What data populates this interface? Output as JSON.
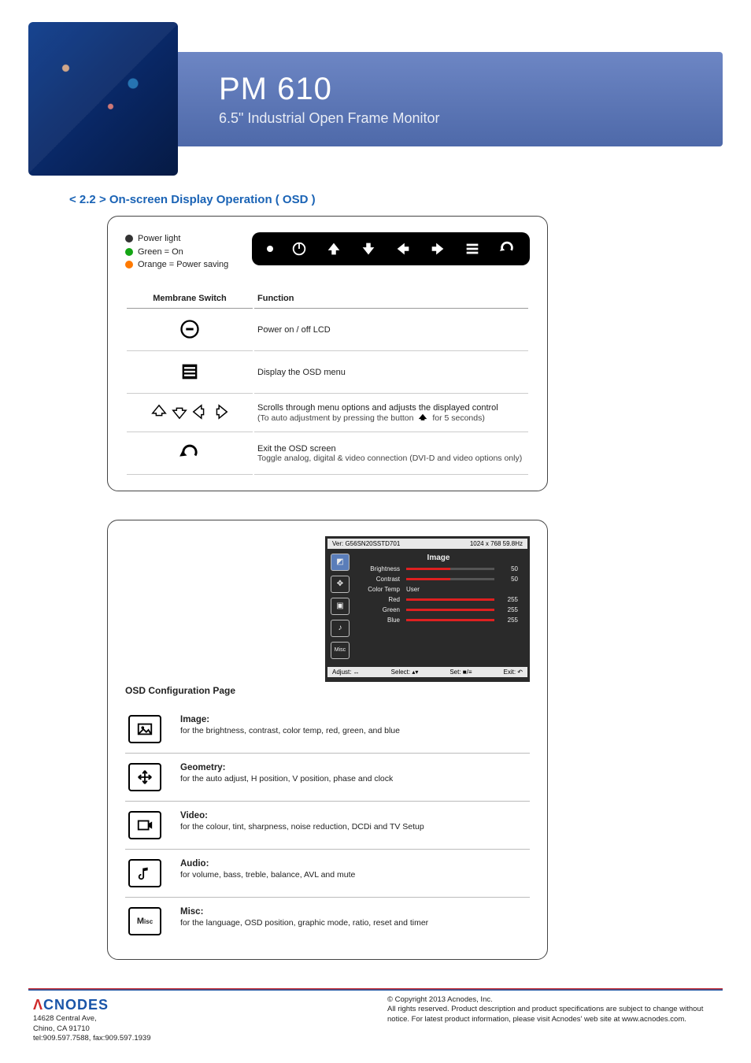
{
  "header": {
    "title": "PM 610",
    "subtitle": "6.5\" Industrial Open Frame Monitor"
  },
  "section_title": "< 2.2 > On-screen Display Operation ( OSD )",
  "legend": {
    "power_light": "Power light",
    "green_on": "Green = On",
    "orange_ps": "Orange = Power saving"
  },
  "switch_table": {
    "col1": "Membrane Switch",
    "col2": "Function",
    "rows": [
      {
        "icon": "power-icon",
        "fn": "Power on / off LCD"
      },
      {
        "icon": "menu-icon",
        "fn": "Display the OSD menu"
      },
      {
        "icon": "arrows-icon",
        "fn": "Scrolls through menu options and adjusts the displayed control",
        "fn2a": "(To auto adjustment by pressing the button",
        "fn2b": "for 5 seconds)"
      },
      {
        "icon": "exit-icon",
        "fn": "Exit the OSD screen",
        "fn2": "Toggle analog, digital & video connection (DVI-D and video options only)"
      }
    ]
  },
  "osd_screen": {
    "ver": "Ver: G56SN20SSTD701",
    "res": "1024 x 768  59.8Hz",
    "menu_title": "Image",
    "rows": [
      {
        "label": "Brightness",
        "value": 50,
        "max": 100
      },
      {
        "label": "Contrast",
        "value": 50,
        "max": 100
      },
      {
        "label": "Color Temp",
        "text": "User"
      },
      {
        "label": "Red",
        "value": 255,
        "max": 255
      },
      {
        "label": "Green",
        "value": 255,
        "max": 255
      },
      {
        "label": "Blue",
        "value": 255,
        "max": 255
      }
    ],
    "footer": {
      "adjust": "Adjust: ↔",
      "select": "Select: ▴▾",
      "set": "Set: ■/≡",
      "exit": "Exit: ↶"
    }
  },
  "config_title": "OSD Configuration Page",
  "config_items": [
    {
      "name": "image-icon",
      "label": "Image:",
      "desc": "for the brightness, contrast, color temp, red, green, and blue"
    },
    {
      "name": "geometry-icon",
      "label": "Geometry:",
      "desc": "for the auto adjust, H position, V position, phase and clock"
    },
    {
      "name": "video-icon",
      "label": "Video:",
      "desc": "for the colour, tint, sharpness, noise reduction, DCDi and TV Setup"
    },
    {
      "name": "audio-icon",
      "label": "Audio:",
      "desc": "for volume, bass, treble, balance, AVL and mute"
    },
    {
      "name": "misc-icon",
      "label": "Misc:",
      "desc": "for the language, OSD position, graphic mode, ratio, reset and timer"
    }
  ],
  "footer": {
    "brand": "ACNODES",
    "addr1": "14628 Central Ave,",
    "addr2": "Chino, CA 91710",
    "tel": "tel:909.597.7588, fax:909.597.1939",
    "copy": "© Copyright 2013 Acnodes, Inc.",
    "legal": "All rights reserved. Product description and product specifications are subject to change without notice. For latest product information, please visit Acnodes' web site at www.acnodes.com."
  }
}
